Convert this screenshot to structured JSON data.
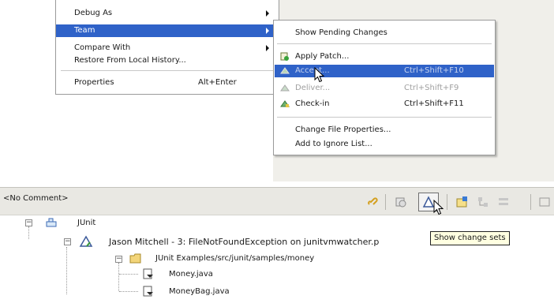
{
  "context_menu": {
    "items": [
      {
        "label": "Debug As",
        "submenu": true
      },
      {
        "label": "Team",
        "submenu": true,
        "selected": true
      },
      {
        "label": "Compare With",
        "submenu": true
      },
      {
        "label": "Restore From Local History...",
        "submenu": false
      },
      {
        "label": "Properties",
        "shortcut": "Alt+Enter",
        "submenu": false
      }
    ]
  },
  "team_submenu": {
    "items": [
      {
        "label": "Show Pending Changes",
        "icon": "none"
      },
      {
        "label": "Apply Patch...",
        "icon": "patch-icon"
      },
      {
        "label": "Accept...",
        "shortcut": "Ctrl+Shift+F10",
        "icon": "accept-icon",
        "highlighted": true
      },
      {
        "label": "Deliver...",
        "shortcut": "Ctrl+Shift+F9",
        "icon": "deliver-icon",
        "disabled": true
      },
      {
        "label": "Check-in",
        "shortcut": "Ctrl+Shift+F11",
        "icon": "check-in-icon"
      },
      {
        "label": "Change File Properties...",
        "icon": "none"
      },
      {
        "label": "Add to Ignore List...",
        "icon": "none"
      }
    ]
  },
  "pending_changes": {
    "comment_placeholder": "<No Comment>",
    "tooltip": "Show change sets",
    "tree": {
      "root": "JUnit",
      "change_set": "Jason Mitchell - 3: FileNotFoundException on junitvmwatcher.p",
      "folder": "JUnit Examples/src/junit/samples/money",
      "files": [
        "Money.java",
        "MoneyBag.java"
      ]
    }
  },
  "colors": {
    "selection": "#2f62c8",
    "panel_bg": "#e9e8e3",
    "disabled_text": "#a0a0a0"
  }
}
